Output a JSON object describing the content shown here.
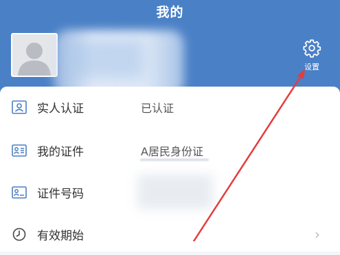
{
  "header": {
    "title": "我的"
  },
  "profile": {
    "avatar_icon": "user-silhouette-icon"
  },
  "settings": {
    "label": "设置",
    "icon": "gear-icon"
  },
  "rows": [
    {
      "label": "实人认证",
      "value": "已认证",
      "icon": "person-card-icon"
    },
    {
      "label": "我的证件",
      "value": "A居民身份证",
      "icon": "id-card-icon"
    },
    {
      "label": "证件号码",
      "value": "",
      "icon": "id-number-icon"
    },
    {
      "label": "有效期始",
      "value": "",
      "icon": "clock-icon"
    }
  ],
  "colors": {
    "header": "#4a80c6",
    "annotation_arrow": "#e63b3b"
  }
}
